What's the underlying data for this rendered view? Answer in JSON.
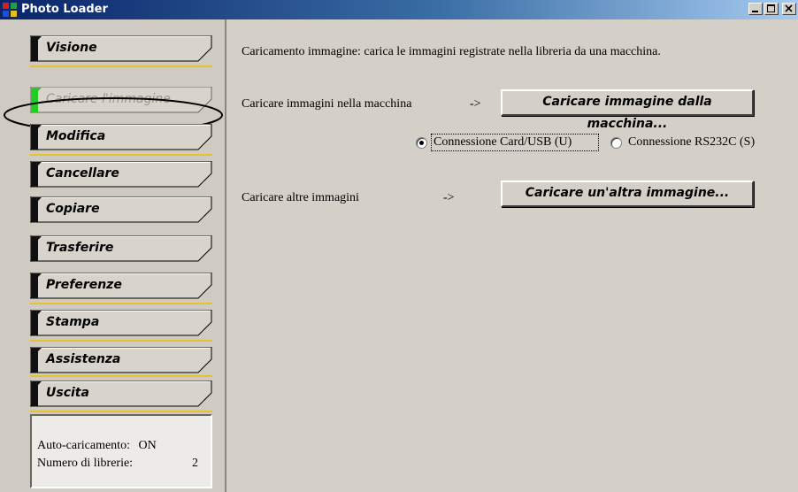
{
  "window": {
    "title": "Photo Loader",
    "controls": {
      "minimize": "minimize-icon",
      "maximize": "maximize-icon",
      "close": "close-icon"
    }
  },
  "sidebar": {
    "items": [
      {
        "label": "Visione",
        "active": false
      },
      {
        "label": "Caricare l'immagine",
        "active": true
      },
      {
        "label": "Modifica",
        "active": false
      },
      {
        "label": "Cancellare",
        "active": false
      },
      {
        "label": "Copiare",
        "active": false
      },
      {
        "label": "Trasferire",
        "active": false
      },
      {
        "label": "Preferenze",
        "active": false
      },
      {
        "label": "Stampa",
        "active": false
      },
      {
        "label": "Assistenza",
        "active": false
      },
      {
        "label": "Uscita",
        "active": false
      }
    ],
    "status": {
      "autoload_label": "Auto-caricamento:",
      "autoload_value": "ON",
      "libraries_label": "Numero di librerie:",
      "libraries_value": "2"
    }
  },
  "main": {
    "description": "Caricamento immagine: carica le immagini registrate nella libreria da una macchina.",
    "load_from_camera": {
      "label": "Caricare immagini nella macchina",
      "arrow": "->",
      "button": "Caricare immagine dalla macchina...",
      "radio_usb": {
        "label": "Connessione Card/USB (U)",
        "checked": true
      },
      "radio_rs232c": {
        "label": "Connessione RS232C (S)",
        "checked": false
      }
    },
    "load_other": {
      "label": "Caricare altre immagini",
      "arrow": "->",
      "button": "Caricare un'altra immagine..."
    }
  },
  "colors": {
    "titlebar_start": "#0a246a",
    "titlebar_end": "#a6caf0",
    "separator": "#e8c228",
    "active_indicator": "#22cc22",
    "panel": "#d4d0c8"
  }
}
